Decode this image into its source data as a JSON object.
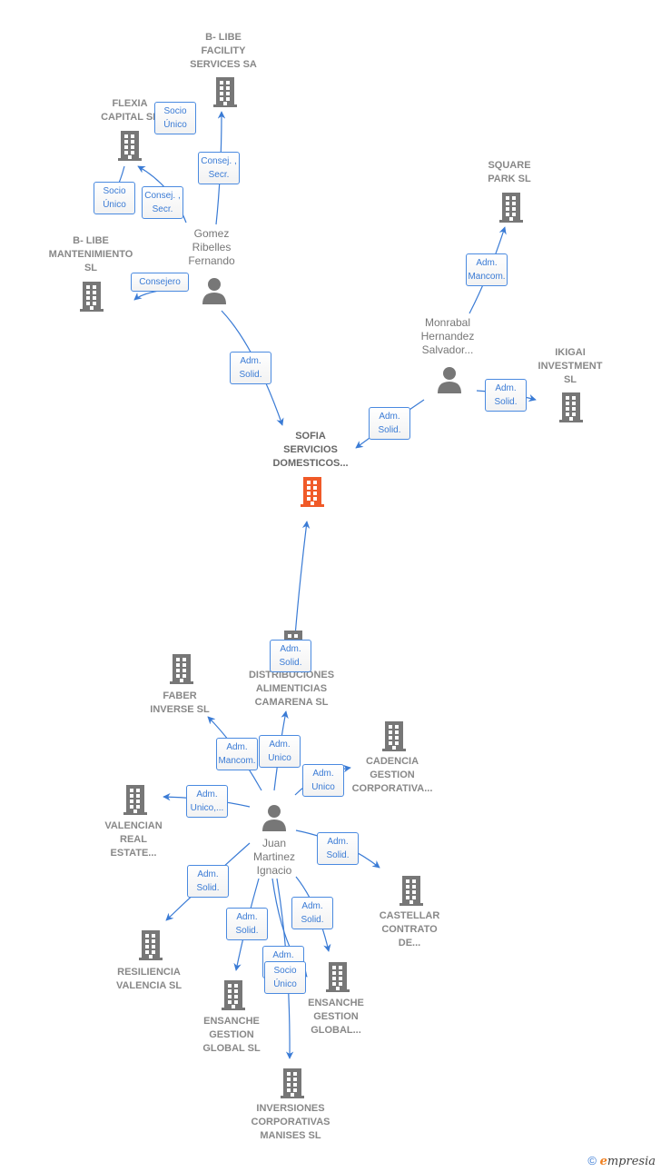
{
  "colors": {
    "edge": "#3a7bd5",
    "node": "#777777",
    "main_node": "#f05a28"
  },
  "nodes": [
    {
      "id": "blibe_facility",
      "type": "company",
      "label": "B- LIBE\nFACILITY\nSERVICES SA"
    },
    {
      "id": "flexia",
      "type": "company",
      "label": "FLEXIA\nCAPITAL  SL"
    },
    {
      "id": "blibe_mant",
      "type": "company",
      "label": "B- LIBE\nMANTENIMIENTO\nSL"
    },
    {
      "id": "gomez",
      "type": "person",
      "label": "Gomez\nRibelles\nFernando"
    },
    {
      "id": "square_park",
      "type": "company",
      "label": "SQUARE\nPARK  SL"
    },
    {
      "id": "monrabal",
      "type": "person",
      "label": "Monrabal\nHernandez\nSalvador..."
    },
    {
      "id": "ikigai",
      "type": "company",
      "label": "IKIGAI\nINVESTMENT\nSL"
    },
    {
      "id": "sofia",
      "type": "main",
      "label": "SOFIA\nSERVICIOS\nDOMESTICOS..."
    },
    {
      "id": "distribuciones",
      "type": "company",
      "label": "DISTRIBUCIONES\nALIMENTICIAS\nCAMARENA  SL"
    },
    {
      "id": "faber",
      "type": "company",
      "label": "FABER\nINVERSE SL"
    },
    {
      "id": "cadencia",
      "type": "company",
      "label": "CADENCIA\nGESTION\nCORPORATIVA..."
    },
    {
      "id": "valencian",
      "type": "company",
      "label": "VALENCIAN\nREAL\nESTATE..."
    },
    {
      "id": "juan",
      "type": "person",
      "label": "Juan\nMartinez\nIgnacio"
    },
    {
      "id": "castellar",
      "type": "company",
      "label": "CASTELLAR\nCONTRATO\nDE..."
    },
    {
      "id": "resiliencia",
      "type": "company",
      "label": "RESILIENCIA\nVALENCIA  SL"
    },
    {
      "id": "ensanche_sl",
      "type": "company",
      "label": "ENSANCHE\nGESTION\nGLOBAL SL"
    },
    {
      "id": "ensanche_global",
      "type": "company",
      "label": "ENSANCHE\nGESTION\nGLOBAL..."
    },
    {
      "id": "inversiones",
      "type": "company",
      "label": "INVERSIONES\nCORPORATIVAS\nMANISES  SL"
    }
  ],
  "edges": [
    {
      "from": "gomez",
      "to": "blibe_facility",
      "label": "Consej. ,\nSecr."
    },
    {
      "from": "gomez",
      "to": "flexia",
      "label": "Consej. ,\nSecr."
    },
    {
      "from": "flexia",
      "to": "blibe_mant",
      "label": "Socio\nÚnico"
    },
    {
      "from": "flexia",
      "to": "blibe_facility",
      "label": "Socio\nÚnico"
    },
    {
      "from": "gomez",
      "to": "blibe_mant",
      "label": "Consejero"
    },
    {
      "from": "gomez",
      "to": "sofia",
      "label": "Adm.\nSolid."
    },
    {
      "from": "monrabal",
      "to": "square_park",
      "label": "Adm.\nMancom."
    },
    {
      "from": "monrabal",
      "to": "sofia",
      "label": "Adm.\nSolid."
    },
    {
      "from": "monrabal",
      "to": "ikigai",
      "label": "Adm.\nSolid."
    },
    {
      "from": "distribuciones",
      "to": "sofia",
      "label": "Adm.\nSolid."
    },
    {
      "from": "juan",
      "to": "faber",
      "label": "Adm.\nMancom."
    },
    {
      "from": "juan",
      "to": "distribuciones",
      "label": "Adm.\nUnico"
    },
    {
      "from": "juan",
      "to": "cadencia",
      "label": "Adm.\nUnico"
    },
    {
      "from": "juan",
      "to": "valencian",
      "label": "Adm.\nUnico,..."
    },
    {
      "from": "juan",
      "to": "castellar",
      "label": "Adm.\nSolid."
    },
    {
      "from": "juan",
      "to": "resiliencia",
      "label": "Adm.\nSolid."
    },
    {
      "from": "juan",
      "to": "ensanche_sl",
      "label": "Adm.\nSolid."
    },
    {
      "from": "juan",
      "to": "ensanche_global",
      "label": "Adm.\nSolid."
    },
    {
      "from": "juan",
      "to": "ensanche_global",
      "label": "Adm.\nSolid."
    },
    {
      "from": "juan",
      "to": "inversiones",
      "label": "Socio\nÚnico"
    }
  ],
  "footer": {
    "copyright": "©",
    "brand_initial": "e",
    "brand_rest": "mpresia"
  }
}
